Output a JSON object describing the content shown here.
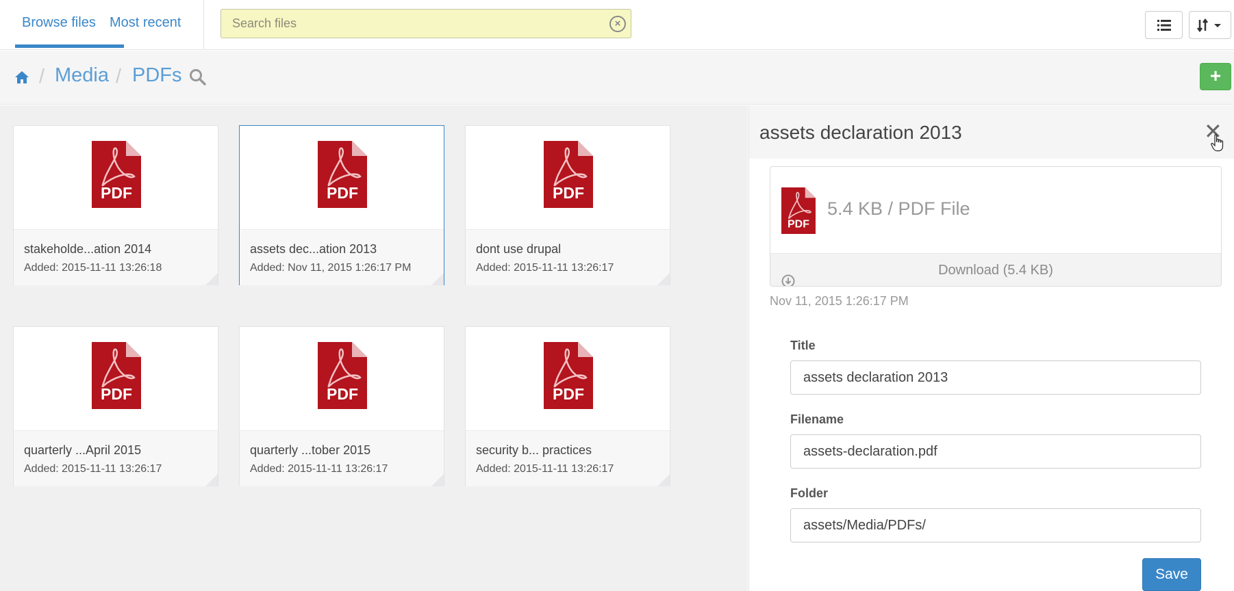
{
  "header": {
    "tabs": [
      {
        "label": "Browse files",
        "active": true
      },
      {
        "label": "Most recent",
        "active": false
      }
    ],
    "search": {
      "placeholder": "Search files",
      "value": "",
      "clear_icon": "clear-circle-icon"
    },
    "tools": [
      {
        "name": "list-view-icon"
      },
      {
        "name": "sort-icon",
        "label": "↓↑▾"
      }
    ]
  },
  "breadcrumb": {
    "home_icon": "home-icon",
    "items": [
      "Media",
      "PDFs"
    ],
    "separator": "/",
    "search_icon": "search-icon",
    "add_label": "+"
  },
  "files": [
    {
      "name": "stakeholde...ation 2014",
      "added": "Added: 2015-11-11 13:26:18",
      "selected": false
    },
    {
      "name": "assets dec...ation 2013",
      "added": "Added: Nov 11, 2015 1:26:17 PM",
      "selected": true
    },
    {
      "name": "dont use drupal",
      "added": "Added: 2015-11-11 13:26:17",
      "selected": false
    },
    {
      "name": "quarterly ...April 2015",
      "added": "Added: 2015-11-11 13:26:17",
      "selected": false
    },
    {
      "name": "quarterly ...tober 2015",
      "added": "Added: 2015-11-11 13:26:17",
      "selected": false
    },
    {
      "name": "security b... practices",
      "added": "Added: 2015-11-11 13:26:17",
      "selected": false
    }
  ],
  "pdf_icon_label": "PDF",
  "detail": {
    "title": "assets declaration 2013",
    "close_label": "✕",
    "file_info": "5.4 KB / PDF File",
    "download_label": "Download (5.4 KB)",
    "date": "Nov 11, 2015 1:26:17 PM",
    "fields": {
      "title_label": "Title",
      "title_value": "assets declaration 2013",
      "filename_label": "Filename",
      "filename_value": "assets-declaration.pdf",
      "folder_label": "Folder",
      "folder_value": "assets/Media/PDFs/"
    },
    "save_label": "Save"
  },
  "colors": {
    "accent": "#3a87c8",
    "add_button": "#5cb85c",
    "pdf_red": "#b3141d",
    "search_bg": "#f7f7c4"
  }
}
